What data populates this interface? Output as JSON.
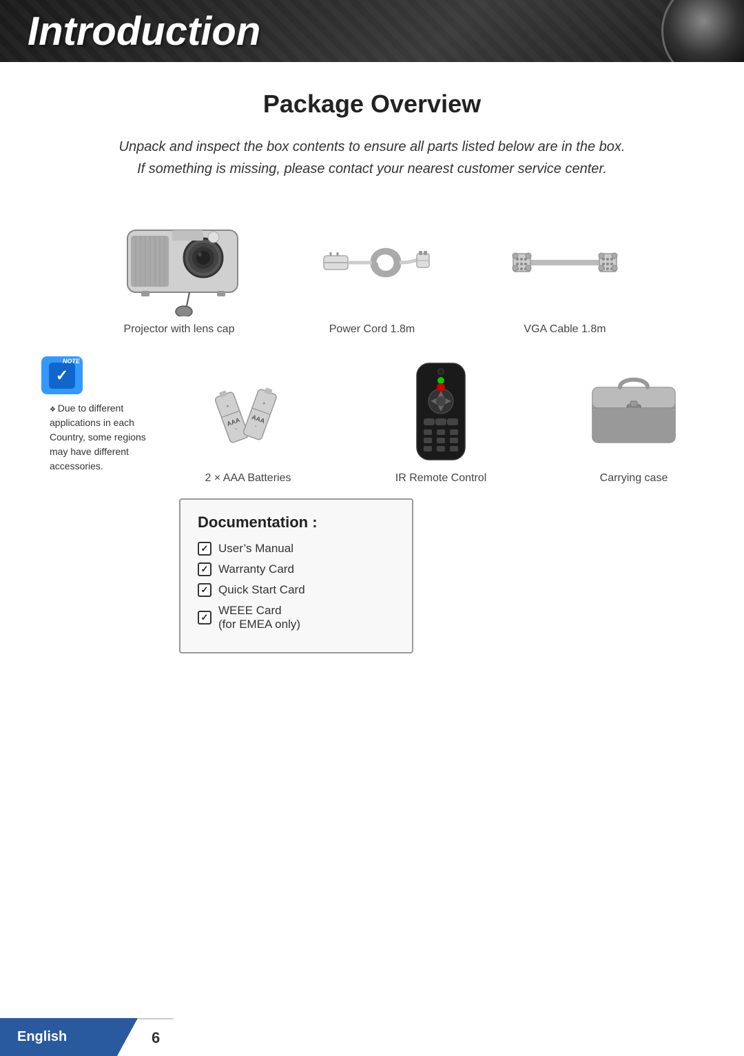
{
  "header": {
    "title": "Introduction"
  },
  "page": {
    "title": "Package Overview",
    "intro": "Unpack and inspect the box contents to ensure all parts listed below are in the box. If something is missing, please contact your nearest customer service center."
  },
  "products": {
    "row1": [
      {
        "label": "Projector with lens cap"
      },
      {
        "label": "Power Cord 1.8m"
      },
      {
        "label": "VGA Cable 1.8m"
      }
    ],
    "row2": [
      {
        "label": "2 × AAA Batteries"
      },
      {
        "label": "IR Remote Control"
      },
      {
        "label": "Carrying case"
      }
    ]
  },
  "note": {
    "icon_label": "Note",
    "text": "Due to different applications in each Country, some regions may have different accessories."
  },
  "documentation": {
    "title": "Documentation :",
    "items": [
      {
        "label": "User’s Manual"
      },
      {
        "label": "Warranty Card"
      },
      {
        "label": "Quick Start Card"
      },
      {
        "label": "WEEE Card"
      },
      {
        "label": "(for EMEA only)"
      }
    ]
  },
  "footer": {
    "language": "English",
    "page_number": "6"
  }
}
